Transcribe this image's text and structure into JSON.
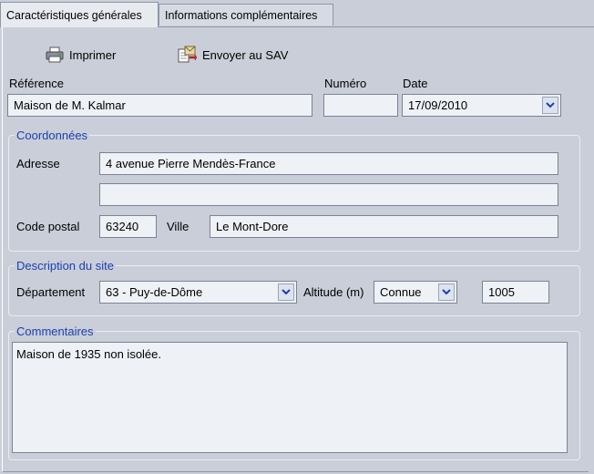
{
  "tabs": [
    {
      "label": "Caractéristiques générales",
      "active": true
    },
    {
      "label": "Informations complémentaires",
      "active": false
    }
  ],
  "toolbar": {
    "print_label": "Imprimer",
    "print_icon": "printer-icon",
    "sav_label": "Envoyer au SAV",
    "sav_icon": "send-document-icon"
  },
  "header": {
    "reference_label": "Référence",
    "reference_value": "Maison de M. Kalmar",
    "numero_label": "Numéro",
    "numero_value": "",
    "date_label": "Date",
    "date_value": "17/09/2010"
  },
  "coordonnees": {
    "title": "Coordonnées",
    "adresse_label": "Adresse",
    "adresse_line1": "4 avenue Pierre Mendès-France",
    "adresse_line2": "",
    "cp_label": "Code postal",
    "cp_value": "63240",
    "ville_label": "Ville",
    "ville_value": "Le Mont-Dore"
  },
  "site": {
    "title": "Description du site",
    "dept_label": "Département",
    "dept_value": "63 - Puy-de-Dôme",
    "altitude_label": "Altitude (m)",
    "altitude_mode": "Connue",
    "altitude_value": "1005"
  },
  "commentaires": {
    "title": "Commentaires",
    "value": "Maison de 1935 non isolée."
  },
  "colors": {
    "group_title": "#1d3fb0",
    "background": "#c9ced8",
    "field_bg": "#eef1f6"
  }
}
